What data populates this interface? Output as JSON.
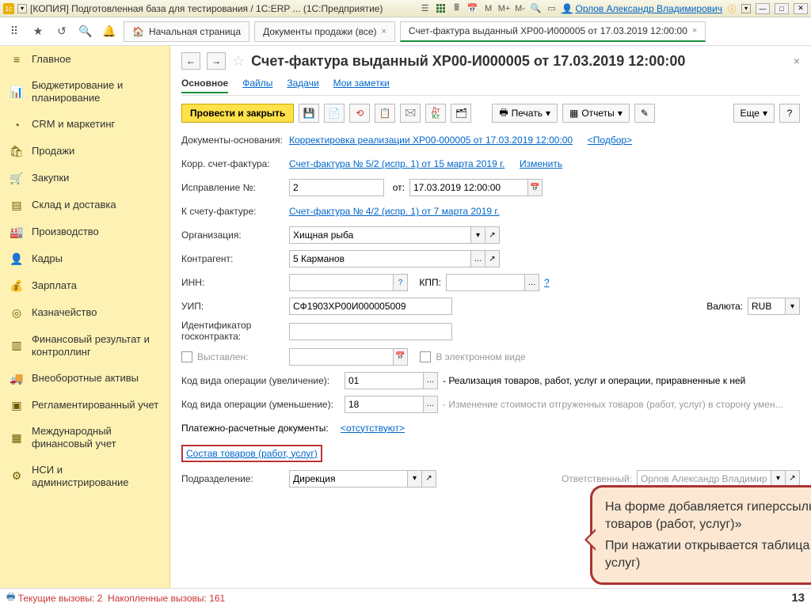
{
  "titlebar": {
    "text": "[КОПИЯ] Подготовленная база для тестирования / 1С:ERP ... (1С:Предприятие)",
    "small_m": "М",
    "small_mp": "М+",
    "small_mm": "М-",
    "user": "Орлов Александр Владимирович"
  },
  "apptabs": {
    "home": "Начальная страница",
    "tab1": "Документы продажи (все)",
    "tab2": "Счет-фактура выданный ХР00-И000005 от 17.03.2019 12:00:00"
  },
  "nav": {
    "items": [
      "Главное",
      "Бюджетирование и планирование",
      "CRM и маркетинг",
      "Продажи",
      "Закупки",
      "Склад и доставка",
      "Производство",
      "Кадры",
      "Зарплата",
      "Казначейство",
      "Финансовый результат и контроллинг",
      "Внеоборотные активы",
      "Регламентированный учет",
      "Международный финансовый учет",
      "НСИ и администрирование"
    ]
  },
  "doc": {
    "title": "Счет-фактура выданный ХР00-И000005 от 17.03.2019 12:00:00",
    "subtabs": {
      "main": "Основное",
      "files": "Файлы",
      "tasks": "Задачи",
      "notes": "Мои заметки"
    },
    "toolbar": {
      "post_close": "Провести и закрыть",
      "print": "Печать",
      "reports": "Отчеты",
      "more": "Еще",
      "help": "?"
    },
    "row_docs": {
      "label": "Документы-основания:",
      "link": "Корректировка реализации ХР00-000005 от 17.03.2019 12:00:00",
      "pick": "<Подбор>"
    },
    "row_corr": {
      "label": "Корр. счет-фактура:",
      "link": "Счет-фактура № 5/2 (испр. 1) от 15 марта 2019 г.",
      "change": "Изменить"
    },
    "row_fix": {
      "label": "Исправление №:",
      "num": "2",
      "from_lbl": "от:",
      "date": "17.03.2019 12:00:00"
    },
    "row_to": {
      "label": "К счету-фактуре:",
      "link": "Счет-фактура № 4/2 (испр. 1) от 7 марта 2019 г."
    },
    "row_org": {
      "label": "Организация:",
      "val": "Хищная рыба"
    },
    "row_ctr": {
      "label": "Контрагент:",
      "val": "5 Карманов"
    },
    "row_inn": {
      "label": "ИНН:",
      "kpp_lbl": "КПП:"
    },
    "row_uip": {
      "label": "УИП:",
      "val": "СФ1903ХР00И000005009",
      "cur_lbl": "Валюта:",
      "cur": "RUB"
    },
    "row_id": {
      "label": "Идентификатор госконтракта:"
    },
    "row_out": {
      "chk": "Выставлен:",
      "e_chk": "В электронном виде"
    },
    "row_code1": {
      "label": "Код вида операции (увеличение):",
      "val": "01",
      "txt": "- Реализация товаров, работ, услуг и операции, приравненные к ней"
    },
    "row_code2": {
      "label": "Код вида операции (уменьшение):",
      "val": "18",
      "txt": "- Изменение стоимости отгруженных товаров (работ, услуг) в сторону умен..."
    },
    "row_pay": {
      "label": "Платежно-расчетные документы:",
      "link": "<отсутствуют>"
    },
    "row_goods": {
      "link": "Состав товаров (работ, услуг)"
    },
    "row_dept": {
      "label": "Подразделение:",
      "val": "Дирекция",
      "resp_lbl": "Ответственный:",
      "resp": "Орлов Александр Владимиров"
    }
  },
  "callout": {
    "l1": "На форме добавляется гиперссылка «Состав товаров (работ, услуг)»",
    "l2": "При нажатии открывается таблица товаров (работ услуг)"
  },
  "status": {
    "calls": "Текущие вызовы:  2",
    "acc": "Накопленные вызовы:  161",
    "page": "13"
  }
}
